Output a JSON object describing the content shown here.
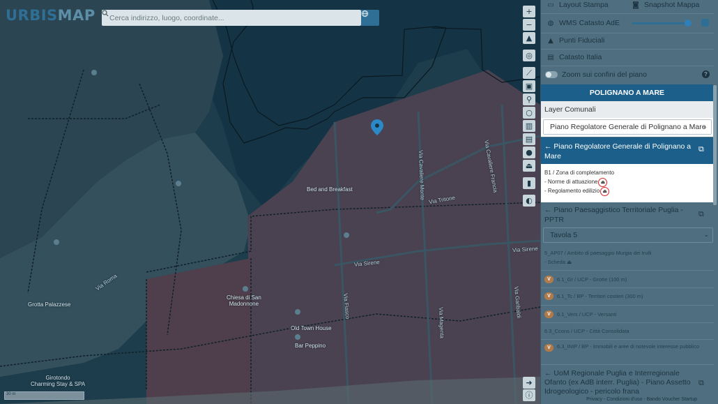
{
  "app": {
    "logo_part1": "URBIS",
    "logo_part2": "MAP"
  },
  "search": {
    "placeholder": "Cerca indirizzo, luogo, coordinate..."
  },
  "map_labels": [
    {
      "text": "Via Tritone"
    },
    {
      "text": "Via Sirene"
    },
    {
      "text": "Via Sirene"
    },
    {
      "text": "Old Town House"
    },
    {
      "text": "Bar Peppino"
    },
    {
      "text": "Chiesa di San\nMadonnone"
    },
    {
      "text": "Bed and Breakfast"
    },
    {
      "text": "Grotta Palazzese"
    },
    {
      "text": "Girotondo\nCharming Stay & SPA"
    },
    {
      "text": "Via Cavaliere Francia"
    },
    {
      "text": "Via Cavaliere Monte"
    },
    {
      "text": "Via Fiasco"
    },
    {
      "text": "Via Magenta"
    },
    {
      "text": "Via Garibaldi"
    },
    {
      "text": "Via Roma"
    }
  ],
  "map": {
    "scale_text": "30 m"
  },
  "panel": {
    "top_items": {
      "layout_stampa": "Layout Stampa",
      "snapshot_mappa": "Snapshot Mappa",
      "wms_catasto": "WMS Catasto AdE",
      "punti_fiduciali": "Punti Fiduciali",
      "catasto_italia": "Catasto Italia",
      "zoom_confini": "Zoom sui confini del piano"
    },
    "comune_title": "POLIGNANO A MARE",
    "layer_comunali_label": "Layer Comunali",
    "layer_select_value": "Piano Regolatore Generale di Polignano a Mare",
    "prg_header": "Piano Regolatore Generale di Polignano a Mare",
    "prg_zone": "B1 / Zona di completamento",
    "prg_doc1": "- Norme di attuazione",
    "prg_doc2": "- Regolamento edilizio",
    "pptr_header": "Piano Paesaggistico Territoriale Puglia - PPTR",
    "tavola_select_value": "Tavola 5",
    "ambito": "5_AP07 / Ambito di paesaggio Murgia dei trulli",
    "scheda": "- Scheda",
    "vincoli": [
      {
        "badge": "V",
        "text": "6.1_Gr / UCP - Grotte (100 m)"
      },
      {
        "badge": "V",
        "text": "6.1_Tc / BP - Territori costieri (300 m)"
      },
      {
        "badge": "V",
        "text": "6.1_Vers / UCP - Versanti"
      },
      {
        "badge": "",
        "text": "6.3_Ccons / UCP - Città Consolidata"
      },
      {
        "badge": "V",
        "text": "6.3_INIP / BP - Immobili e aree di notevole interesse pubblico"
      }
    ],
    "uom_header": "UoM Regionale Puglia e Interregionale Ofanto (ex AdB interr. Puglia) - Piano Assetto Idrogeologico - pericolo frana",
    "footer": "Privacy - Condizioni d'uso - Bando Voucher Startup"
  },
  "colors": {
    "accent": "#1b5f8a",
    "red_circle": "#dd2222",
    "badge_brown": "#b07a4a"
  }
}
